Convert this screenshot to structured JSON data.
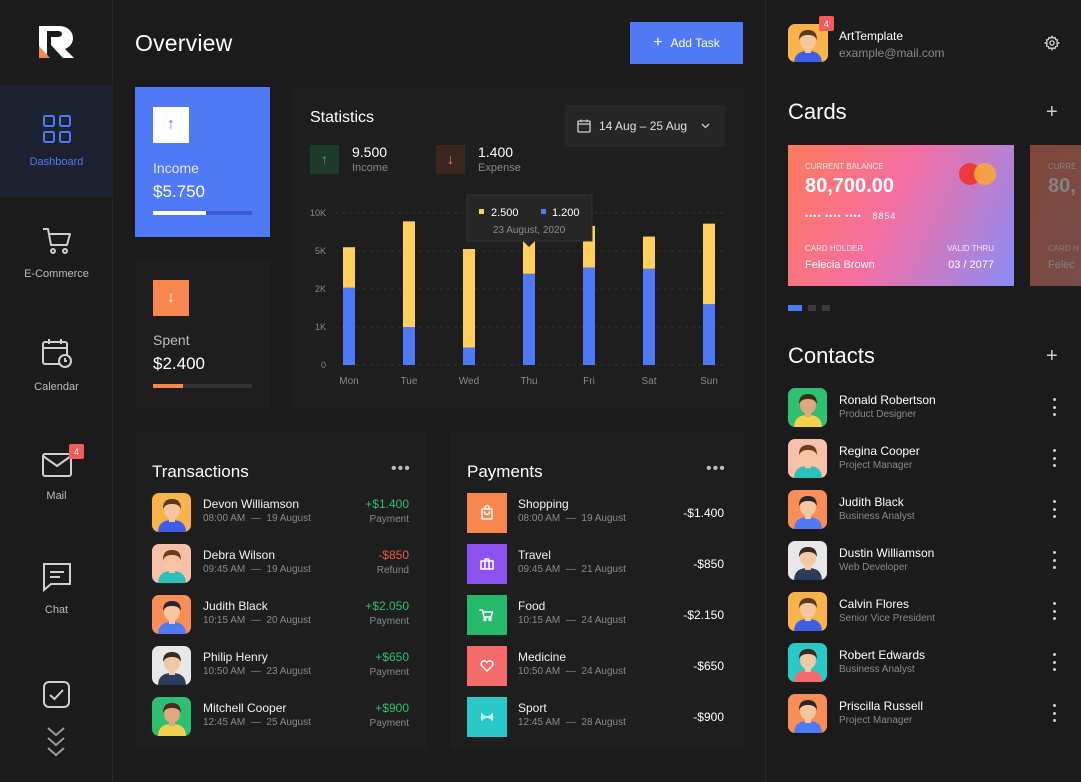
{
  "sidebar": {
    "items": [
      {
        "label": "Dashboard",
        "icon": "grid-icon"
      },
      {
        "label": "E-Commerce",
        "icon": "cart-icon"
      },
      {
        "label": "Calendar",
        "icon": "calendar-icon"
      },
      {
        "label": "Mail",
        "icon": "mail-icon",
        "badge": "4"
      },
      {
        "label": "Chat",
        "icon": "chat-icon"
      }
    ]
  },
  "header": {
    "title": "Overview",
    "add_task_label": "Add Task"
  },
  "income": {
    "label": "Income",
    "value": "$5.750",
    "progress": 0.54
  },
  "spent": {
    "label": "Spent",
    "value": "$2.400",
    "progress": 0.3
  },
  "statistics": {
    "title": "Statistics",
    "date_range": "14 Aug – 25 Aug",
    "income_value": "9.500",
    "income_label": "Income",
    "expense_value": "1.400",
    "expense_label": "Expense",
    "tooltip": {
      "income": "2.500",
      "expense": "1.200",
      "date": "23 August, 2020"
    }
  },
  "chart_data": {
    "type": "bar",
    "stacked": true,
    "categories": [
      "Mon",
      "Tue",
      "Wed",
      "Thu",
      "Fri",
      "Sat",
      "Sun"
    ],
    "ticks": [
      "10K",
      "5K",
      "2K",
      "1K",
      "0"
    ],
    "series": [
      {
        "values": [
          2100,
          1000,
          460,
          3200,
          3700,
          3600,
          1600
        ],
        "color": "#4f79f5"
      },
      {
        "values": [
          3400,
          7900,
          4800,
          3100,
          4600,
          3300,
          7000
        ],
        "color": "#ffcf5c"
      }
    ],
    "ylim": [
      0,
      10000
    ],
    "grid": true
  },
  "transactions": {
    "title": "Transactions",
    "rows": [
      {
        "name": "Devon Williamson",
        "time": "08:00 AM",
        "date": "19 August",
        "amount": "+$1.400",
        "status": "Payment",
        "positive": true,
        "bg": "#f8b34b",
        "skin": "#f7c59f",
        "hair": "#5a3a22",
        "shirt": "#3f5ee8"
      },
      {
        "name": "Debra Wilson",
        "time": "09:45 AM",
        "date": "19 August",
        "amount": "-$850",
        "status": "Refund",
        "positive": false,
        "bg": "#f7c1a9",
        "skin": "#f7c59f",
        "hair": "#6b3d1f",
        "shirt": "#29c1b8"
      },
      {
        "name": "Judith Black",
        "time": "10:15 AM",
        "date": "20 August",
        "amount": "+$2.050",
        "status": "Payment",
        "positive": true,
        "bg": "#fb8e58",
        "skin": "#f7c59f",
        "hair": "#2b2430",
        "shirt": "#4f79f5"
      },
      {
        "name": "Philip Henry",
        "time": "10:50 AM",
        "date": "23 August",
        "amount": "+$650",
        "status": "Payment",
        "positive": true,
        "bg": "#e8e8e8",
        "skin": "#f2c9a6",
        "hair": "#3a2a22",
        "shirt": "#2d3b5c"
      },
      {
        "name": "Mitchell Cooper",
        "time": "12:45 AM",
        "date": "25 August",
        "amount": "+$900",
        "status": "Payment",
        "positive": true,
        "bg": "#2fbf71",
        "skin": "#e0a87c",
        "hair": "#4a2c1a",
        "shirt": "#f2d14b"
      }
    ]
  },
  "payments": {
    "title": "Payments",
    "rows": [
      {
        "name": "Shopping",
        "time": "08:00 AM",
        "date": "19 August",
        "amount": "-$1.400",
        "icon": "bag-icon",
        "color": "#f8864f"
      },
      {
        "name": "Travel",
        "time": "09:45 AM",
        "date": "21 August",
        "amount": "-$850",
        "icon": "suitcase-icon",
        "color": "#8c52f0"
      },
      {
        "name": "Food",
        "time": "10:15 AM",
        "date": "24 August",
        "amount": "-$2.150",
        "icon": "cart-icon",
        "color": "#27b96a"
      },
      {
        "name": "Medicine",
        "time": "10:50 AM",
        "date": "24 August",
        "amount": "-$650",
        "icon": "heart-icon",
        "color": "#f56b6b"
      },
      {
        "name": "Sport",
        "time": "12:45 AM",
        "date": "28 August",
        "amount": "-$900",
        "icon": "dumbbell-icon",
        "color": "#2bc8c8"
      }
    ]
  },
  "user": {
    "name": "ArtTemplate",
    "email": "example@mail.com",
    "badge": "4"
  },
  "cards": {
    "title": "Cards",
    "balance_label": "CURRENT BALANCE",
    "balance": "80,700.00",
    "number_mask": "•••• •••• ••••",
    "number_last": "8854",
    "holder_label": "CARD HOLDER",
    "holder": "Felecia Brown",
    "valid_label": "VALID THRU",
    "valid": "03 / 2077",
    "peek_balance_label": "CURRE",
    "peek_balance": "80,",
    "peek_holder_label": "CARD H",
    "peek_holder": "Felec"
  },
  "contacts": {
    "title": "Contacts",
    "items": [
      {
        "name": "Ronald Robertson",
        "role": "Product Designer",
        "bg": "#2fbf71",
        "skin": "#e0a87c",
        "hair": "#3a2a1e",
        "shirt": "#f2d14b"
      },
      {
        "name": "Regina Cooper",
        "role": "Project Manager",
        "bg": "#f7c1a9",
        "skin": "#f7c59f",
        "hair": "#6b3d1f",
        "shirt": "#29c1b8"
      },
      {
        "name": "Judith Black",
        "role": "Business Analyst",
        "bg": "#fb8e58",
        "skin": "#f7c59f",
        "hair": "#2b2430",
        "shirt": "#4f79f5"
      },
      {
        "name": "Dustin Williamson",
        "role": "Web Developer",
        "bg": "#e8e8e8",
        "skin": "#f2c9a6",
        "hair": "#3a2a22",
        "shirt": "#2d3b5c"
      },
      {
        "name": "Calvin Flores",
        "role": "Senior Vice President",
        "bg": "#f8b34b",
        "skin": "#f7c59f",
        "hair": "#5a3a22",
        "shirt": "#3f5ee8"
      },
      {
        "name": "Robert Edwards",
        "role": "Business Analyst",
        "bg": "#2bc8c8",
        "skin": "#f2c9a6",
        "hair": "#3a2a22",
        "shirt": "#f56b6b"
      },
      {
        "name": "Priscilla Russell",
        "role": "Project Manager",
        "bg": "#fb8e58",
        "skin": "#f7c59f",
        "hair": "#2b2430",
        "shirt": "#4f79f5"
      }
    ]
  },
  "colors": {
    "accent": "#4f79f5",
    "income": "#ffcf5c",
    "positive": "#2fbf71",
    "negative": "#f2543d",
    "spent": "#f8864f"
  }
}
